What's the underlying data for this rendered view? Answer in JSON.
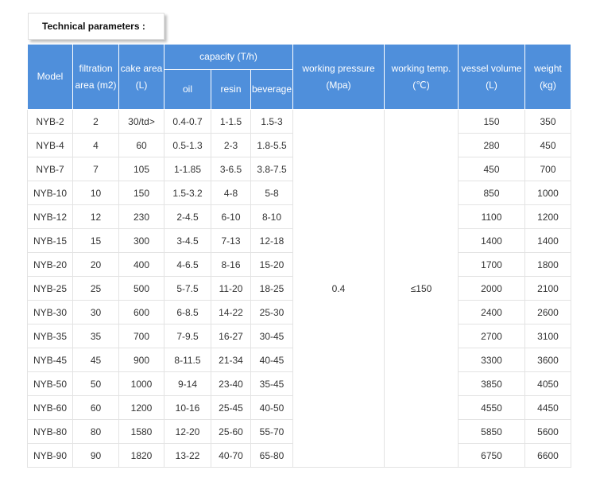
{
  "title": "Technical parameters :",
  "headers": {
    "model": "Model",
    "filtration_area": "filtration area (m2)",
    "cake_area": "cake area (L)",
    "capacity": "capacity (T/h)",
    "oil": "oil",
    "resin": "resin",
    "beverage": "beverage",
    "working_pressure": "working pressure (Mpa)",
    "working_temp": "working temp. (℃)",
    "vessel_volume": "vessel volume (L)",
    "weight": "weight (kg)"
  },
  "shared": {
    "pressure": "0.4",
    "temp": "≤150"
  },
  "rows": [
    {
      "model": "NYB-2",
      "area": "2",
      "cake": "30/td>",
      "oil": "0.4-0.7",
      "resin": "1-1.5",
      "beverage": "1.5-3",
      "volume": "150",
      "weight": "350"
    },
    {
      "model": "NYB-4",
      "area": "4",
      "cake": "60",
      "oil": "0.5-1.3",
      "resin": "2-3",
      "beverage": "1.8-5.5",
      "volume": "280",
      "weight": "450"
    },
    {
      "model": "NYB-7",
      "area": "7",
      "cake": "105",
      "oil": "1-1.85",
      "resin": "3-6.5",
      "beverage": "3.8-7.5",
      "volume": "450",
      "weight": "700"
    },
    {
      "model": "NYB-10",
      "area": "10",
      "cake": "150",
      "oil": "1.5-3.2",
      "resin": "4-8",
      "beverage": "5-8",
      "volume": "850",
      "weight": "1000"
    },
    {
      "model": "NYB-12",
      "area": "12",
      "cake": "230",
      "oil": "2-4.5",
      "resin": "6-10",
      "beverage": "8-10",
      "volume": "1100",
      "weight": "1200"
    },
    {
      "model": "NYB-15",
      "area": "15",
      "cake": "300",
      "oil": "3-4.5",
      "resin": "7-13",
      "beverage": "12-18",
      "volume": "1400",
      "weight": "1400"
    },
    {
      "model": "NYB-20",
      "area": "20",
      "cake": "400",
      "oil": "4-6.5",
      "resin": "8-16",
      "beverage": "15-20",
      "volume": "1700",
      "weight": "1800"
    },
    {
      "model": "NYB-25",
      "area": "25",
      "cake": "500",
      "oil": "5-7.5",
      "resin": "11-20",
      "beverage": "18-25",
      "volume": "2000",
      "weight": "2100"
    },
    {
      "model": "NYB-30",
      "area": "30",
      "cake": "600",
      "oil": "6-8.5",
      "resin": "14-22",
      "beverage": "25-30",
      "volume": "2400",
      "weight": "2600"
    },
    {
      "model": "NYB-35",
      "area": "35",
      "cake": "700",
      "oil": "7-9.5",
      "resin": "16-27",
      "beverage": "30-45",
      "volume": "2700",
      "weight": "3100"
    },
    {
      "model": "NYB-45",
      "area": "45",
      "cake": "900",
      "oil": "8-11.5",
      "resin": "21-34",
      "beverage": "40-45",
      "volume": "3300",
      "weight": "3600"
    },
    {
      "model": "NYB-50",
      "area": "50",
      "cake": "1000",
      "oil": "9-14",
      "resin": "23-40",
      "beverage": "35-45",
      "volume": "3850",
      "weight": "4050"
    },
    {
      "model": "NYB-60",
      "area": "60",
      "cake": "1200",
      "oil": "10-16",
      "resin": "25-45",
      "beverage": "40-50",
      "volume": "4550",
      "weight": "4450"
    },
    {
      "model": "NYB-80",
      "area": "80",
      "cake": "1580",
      "oil": "12-20",
      "resin": "25-60",
      "beverage": "55-70",
      "volume": "5850",
      "weight": "5600"
    },
    {
      "model": "NYB-90",
      "area": "90",
      "cake": "1820",
      "oil": "13-22",
      "resin": "40-70",
      "beverage": "65-80",
      "volume": "6750",
      "weight": "6600"
    }
  ]
}
